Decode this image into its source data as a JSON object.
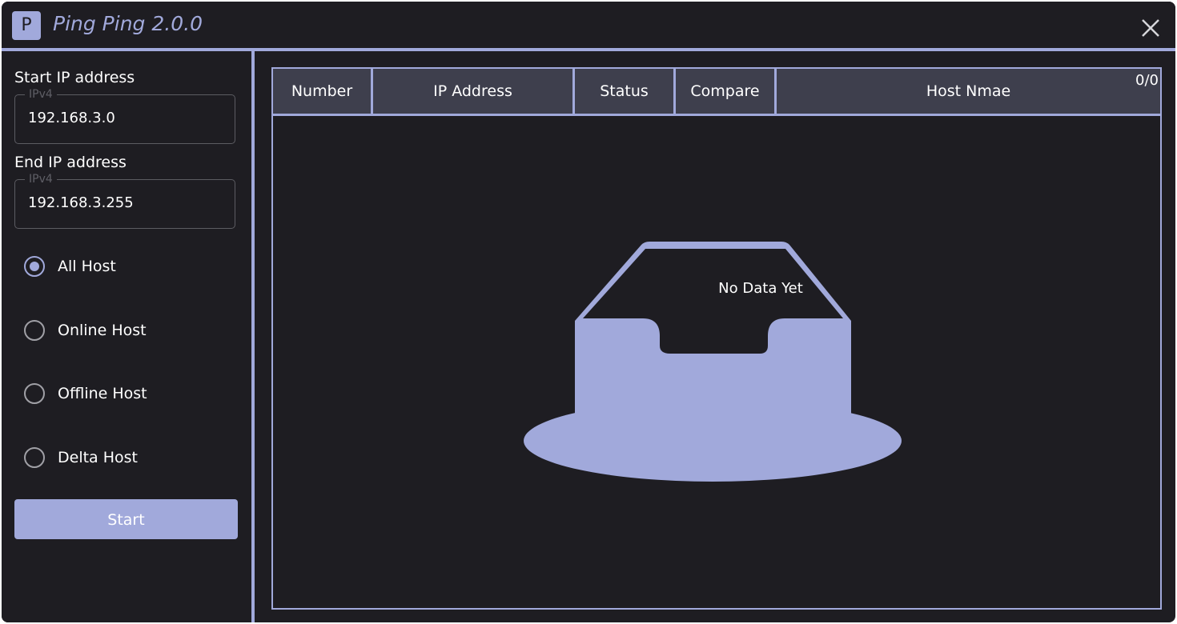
{
  "app": {
    "logo_letter": "P",
    "title": "Ping Ping 2.0.0"
  },
  "sidebar": {
    "start_ip": {
      "label": "Start IP address",
      "legend": "IPv4",
      "value": "192.168.3.0"
    },
    "end_ip": {
      "label": "End IP address",
      "legend": "IPv4",
      "value": "192.168.3.255"
    },
    "filters": [
      {
        "label": "All Host",
        "checked": true
      },
      {
        "label": "Online Host",
        "checked": false
      },
      {
        "label": "Offline Host",
        "checked": false
      },
      {
        "label": "Delta Host",
        "checked": false
      }
    ],
    "start_button": "Start"
  },
  "table": {
    "columns": [
      "Number",
      "IP Address",
      "Status",
      "Compare",
      "Host Nmae"
    ],
    "count": "0/0",
    "empty_text": "No Data Yet"
  },
  "colors": {
    "accent": "#a1a9db",
    "background": "#1e1d22",
    "header_bg": "#3e3f4d"
  }
}
